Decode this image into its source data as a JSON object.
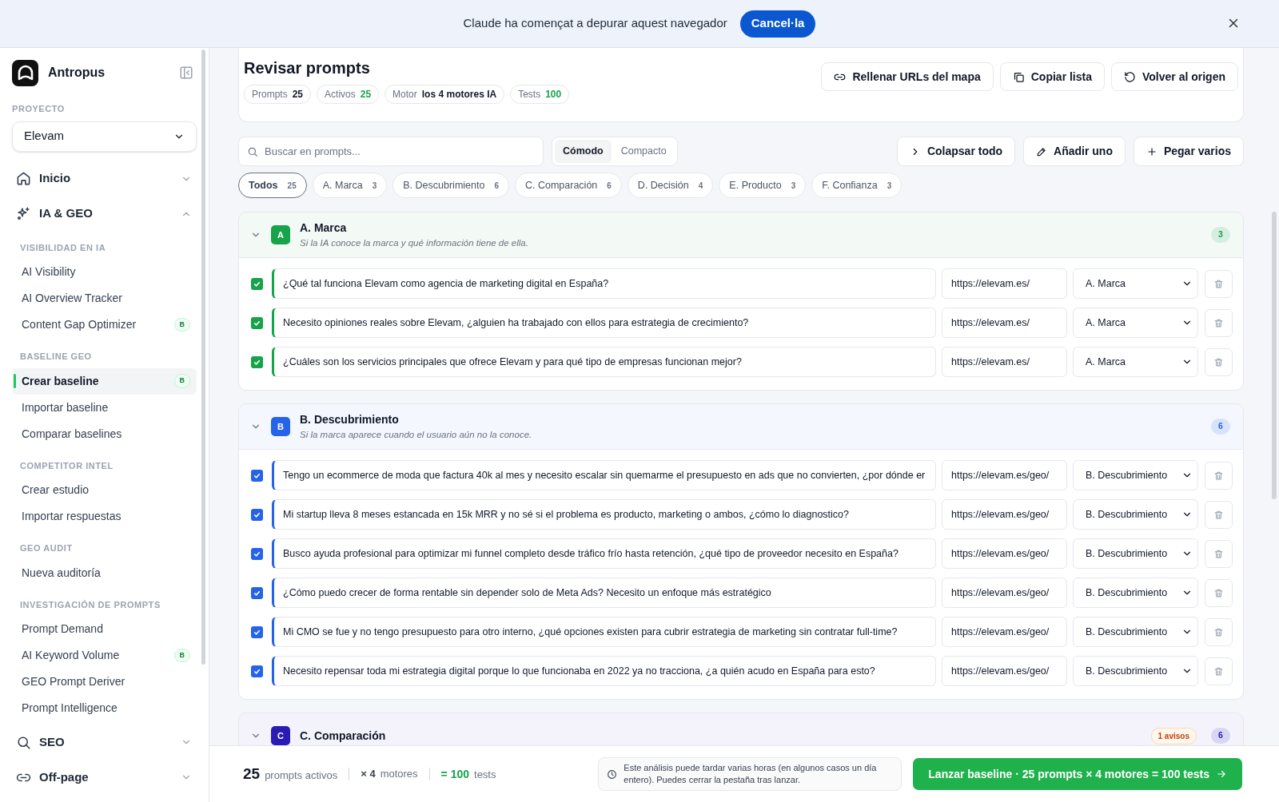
{
  "banner": {
    "text": "Claude ha començat a depurar aquest navegador",
    "button": "Cancel·la"
  },
  "sidebar": {
    "brand": "Antropus",
    "project_label": "PROYECTO",
    "project": "Elevam",
    "nav": [
      {
        "label": "Inicio",
        "expanded": false
      },
      {
        "label": "IA & GEO",
        "expanded": true,
        "sections": [
          {
            "heading": "VISIBILIDAD EN IA",
            "items": [
              {
                "label": "AI Visibility",
                "selected": false
              },
              {
                "label": "AI Overview Tracker",
                "selected": false
              },
              {
                "label": "Content Gap Optimizer",
                "selected": false,
                "badge": "B"
              }
            ]
          },
          {
            "heading": "BASELINE GEO",
            "items": [
              {
                "label": "Crear baseline",
                "selected": true,
                "badge": "B"
              },
              {
                "label": "Importar baseline",
                "selected": false
              },
              {
                "label": "Comparar baselines",
                "selected": false
              }
            ]
          },
          {
            "heading": "COMPETITOR INTEL",
            "items": [
              {
                "label": "Crear estudio",
                "selected": false
              },
              {
                "label": "Importar respuestas",
                "selected": false
              }
            ]
          },
          {
            "heading": "GEO AUDIT",
            "items": [
              {
                "label": "Nueva auditoría",
                "selected": false
              }
            ]
          },
          {
            "heading": "INVESTIGACIÓN DE PROMPTS",
            "items": [
              {
                "label": "Prompt Demand",
                "selected": false
              },
              {
                "label": "AI Keyword Volume",
                "selected": false,
                "badge": "B"
              },
              {
                "label": "GEO Prompt Deriver",
                "selected": false
              },
              {
                "label": "Prompt Intelligence",
                "selected": false
              }
            ]
          }
        ]
      },
      {
        "label": "SEO",
        "expanded": false
      },
      {
        "label": "Off-page",
        "expanded": false
      }
    ]
  },
  "header": {
    "title": "Revisar prompts",
    "stats": [
      {
        "label": "Prompts",
        "value": "25",
        "highlight": false
      },
      {
        "label": "Activos",
        "value": "25",
        "highlight": true
      },
      {
        "label": "Motor",
        "value": "los 4 motores IA",
        "highlight": false
      },
      {
        "label": "Tests",
        "value": "100",
        "highlight": true
      }
    ],
    "buttons": [
      "Rellenar URLs del mapa",
      "Copiar lista",
      "Volver al origen"
    ]
  },
  "toolbar": {
    "search_placeholder": "Buscar en prompts...",
    "views": [
      {
        "label": "Cómodo",
        "selected": true
      },
      {
        "label": "Compacto",
        "selected": false
      }
    ],
    "buttons": [
      "Colapsar todo",
      "Añadir uno",
      "Pegar varios"
    ]
  },
  "chips": [
    {
      "label": "Todos",
      "count": "25",
      "selected": true
    },
    {
      "label": "A. Marca",
      "count": "3",
      "selected": false
    },
    {
      "label": "B. Descubrimiento",
      "count": "6",
      "selected": false
    },
    {
      "label": "C. Comparación",
      "count": "6",
      "selected": false
    },
    {
      "label": "D. Decisión",
      "count": "4",
      "selected": false
    },
    {
      "label": "E. Producto",
      "count": "3",
      "selected": false
    },
    {
      "label": "F. Confianza",
      "count": "3",
      "selected": false
    }
  ],
  "groups": [
    {
      "letter": "A",
      "title": "A. Marca",
      "subtitle": "Si la IA conoce la marca y qué información tiene de ella.",
      "count": "3",
      "color": "#16a34a",
      "expanded": true,
      "rows": [
        {
          "text": "¿Qué tal funciona Elevam como agencia de marketing digital en España?",
          "url": "https://elevam.es/",
          "category": "A. Marca",
          "checked": true
        },
        {
          "text": "Necesito opiniones reales sobre Elevam, ¿alguien ha trabajado con ellos para estrategia de crecimiento?",
          "url": "https://elevam.es/",
          "category": "A. Marca",
          "checked": true
        },
        {
          "text": "¿Cuáles son los servicios principales que ofrece Elevam y para qué tipo de empresas funcionan mejor?",
          "url": "https://elevam.es/",
          "category": "A. Marca",
          "checked": true
        }
      ]
    },
    {
      "letter": "B",
      "title": "B. Descubrimiento",
      "subtitle": "Si la marca aparece cuando el usuario aún no la conoce.",
      "count": "6",
      "color": "#2563eb",
      "expanded": true,
      "rows": [
        {
          "text": "Tengo un ecommerce de moda que factura 40k al mes y necesito escalar sin quemarme el presupuesto en ads que no convierten, ¿por dónde er",
          "url": "https://elevam.es/geo/",
          "category": "B. Descubrimiento",
          "checked": true
        },
        {
          "text": "Mi startup lleva 8 meses estancada en 15k MRR y no sé si el problema es producto, marketing o ambos, ¿cómo lo diagnostico?",
          "url": "https://elevam.es/geo/",
          "category": "B. Descubrimiento",
          "checked": true
        },
        {
          "text": "Busco ayuda profesional para optimizar mi funnel completo desde tráfico frío hasta retención, ¿qué tipo de proveedor necesito en España?",
          "url": "https://elevam.es/geo/",
          "category": "B. Descubrimiento",
          "checked": true
        },
        {
          "text": "¿Cómo puedo crecer de forma rentable sin depender solo de Meta Ads? Necesito un enfoque más estratégico",
          "url": "https://elevam.es/geo/",
          "category": "B. Descubrimiento",
          "checked": true
        },
        {
          "text": "Mi CMO se fue y no tengo presupuesto para otro interno, ¿qué opciones existen para cubrir estrategia de marketing sin contratar full-time?",
          "url": "https://elevam.es/geo/",
          "category": "B. Descubrimiento",
          "checked": true
        },
        {
          "text": "Necesito repensar toda mi estrategia digital porque lo que funcionaba en 2022 ya no tracciona, ¿a quién acudo en España para esto?",
          "url": "https://elevam.es/geo/",
          "category": "B. Descubrimiento",
          "checked": true
        }
      ]
    },
    {
      "letter": "C",
      "title": "C. Comparación",
      "count": "6",
      "color": "#2a1bb5",
      "expanded": true,
      "warning": "1 avisos"
    }
  ],
  "footer": {
    "count": "25",
    "count_label": "prompts activos",
    "engines": "× 4",
    "engines_label": "motores",
    "tests": "= 100",
    "tests_label": "tests",
    "note": "Este análisis puede tardar varias horas (en algunos casos un día entero). Puedes cerrar la pestaña tras lanzar.",
    "launch": "Lanzar baseline · 25 prompts × 4 motores = 100 tests"
  }
}
